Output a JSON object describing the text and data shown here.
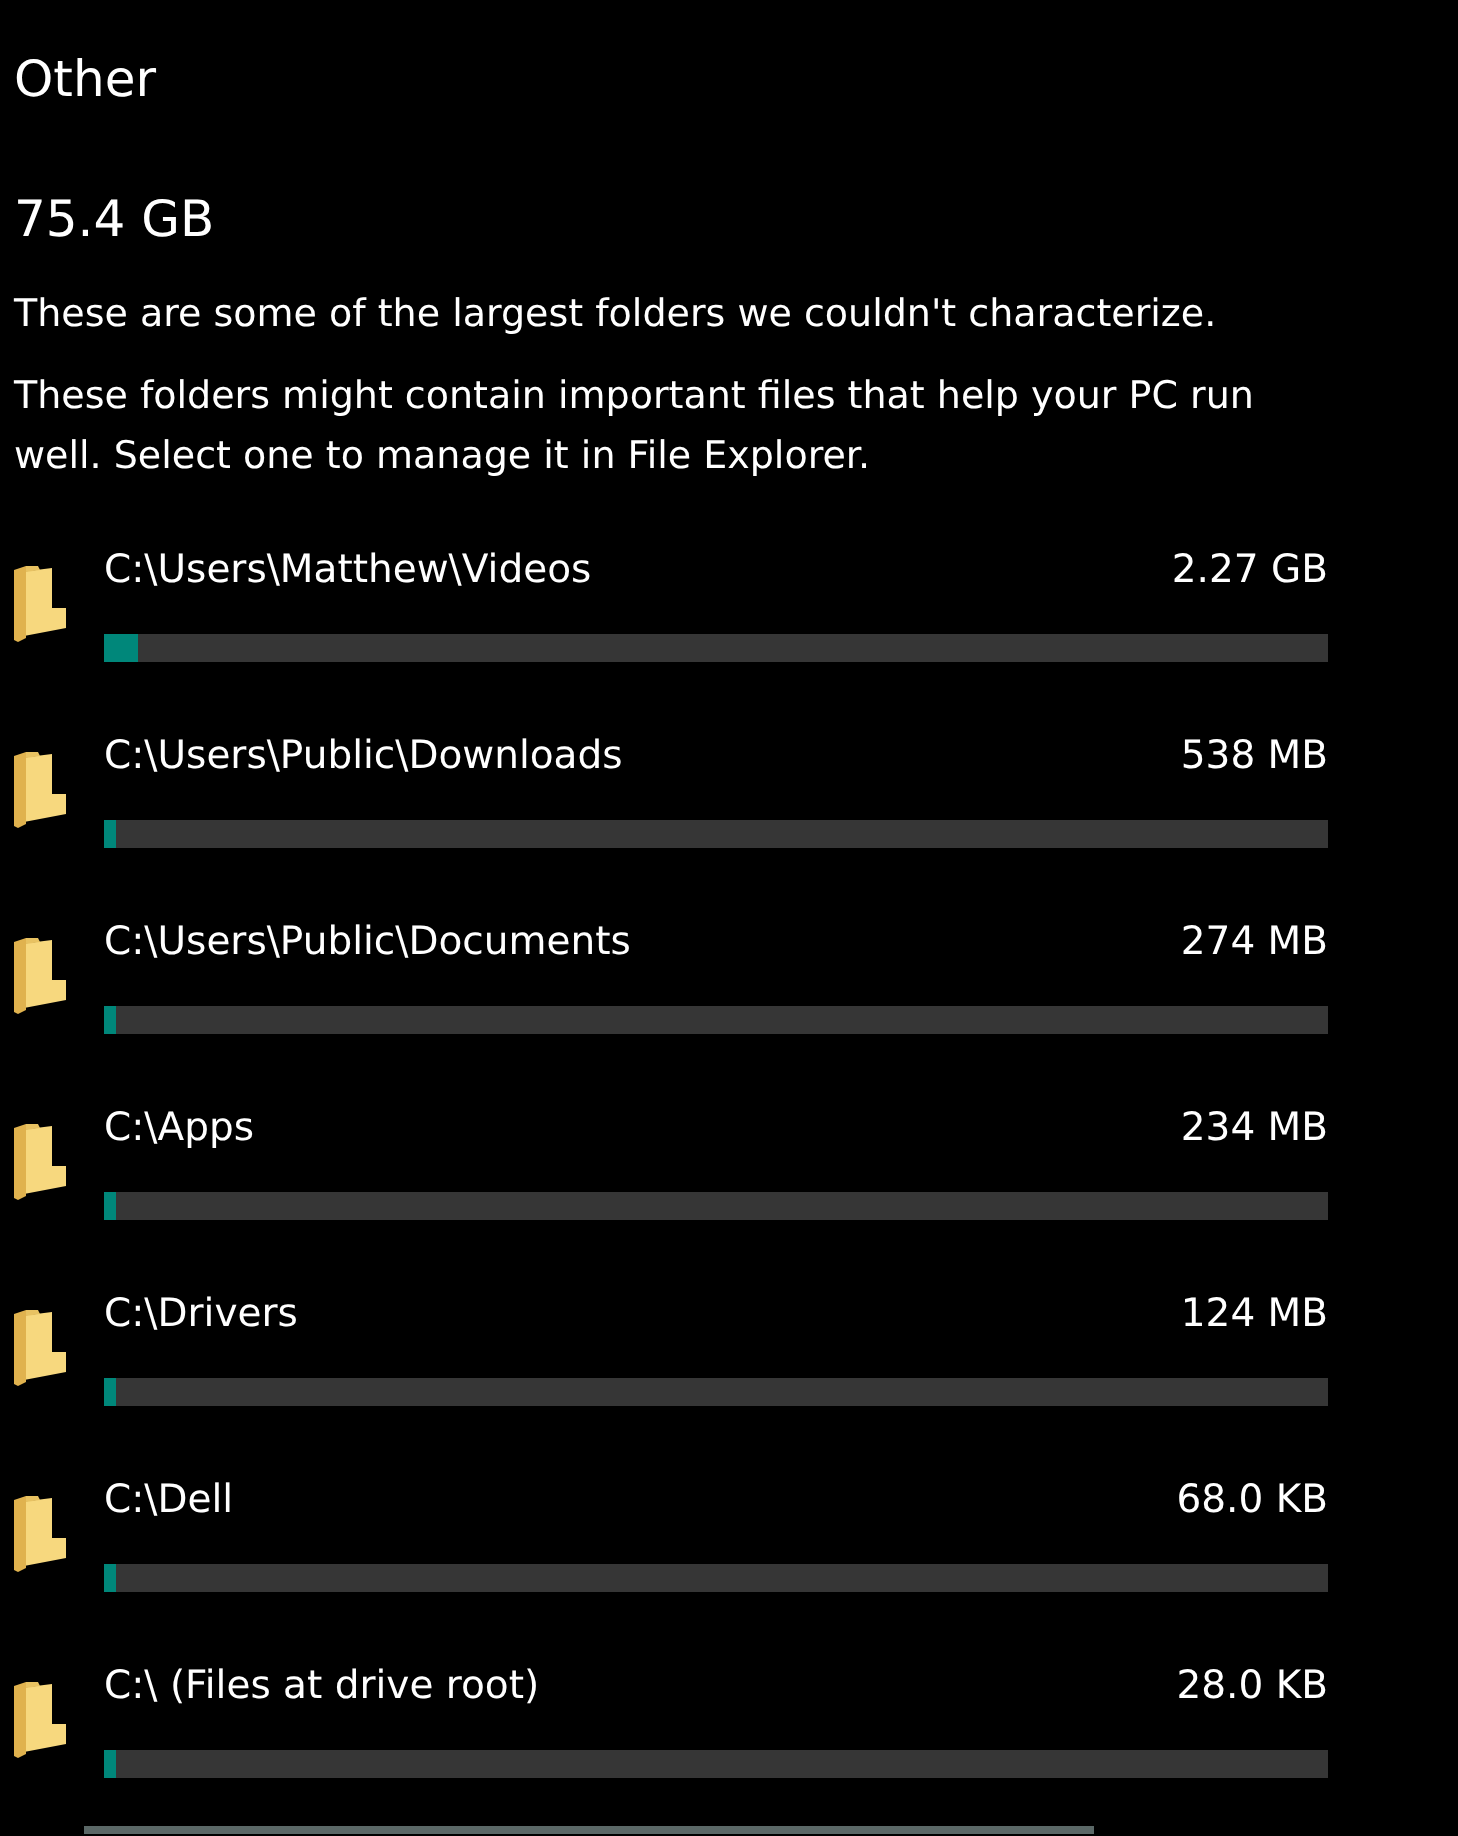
{
  "title": "Other",
  "total": "75.4 GB",
  "description": [
    "These are some of the largest folders we couldn't characterize.",
    "These folders might contain important files that help your PC run well. Select one to manage it in File Explorer."
  ],
  "folders": [
    {
      "path": "C:\\Users\\Matthew\\Videos",
      "size": "2.27 GB",
      "level": 0.028
    },
    {
      "path": "C:\\Users\\Public\\Downloads",
      "size": "538 MB",
      "level": 0.009
    },
    {
      "path": "C:\\Users\\Public\\Documents",
      "size": "274 MB",
      "level": 0.009
    },
    {
      "path": "C:\\Apps",
      "size": "234 MB",
      "level": 0.009
    },
    {
      "path": "C:\\Drivers",
      "size": "124 MB",
      "level": 0.009
    },
    {
      "path": "C:\\Dell",
      "size": "68.0 KB",
      "level": 0.009
    },
    {
      "path": "C:\\ (Files at drive root)",
      "size": "28.0 KB",
      "level": 0.009
    }
  ]
}
